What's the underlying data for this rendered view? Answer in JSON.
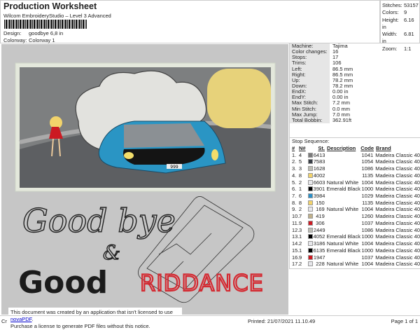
{
  "header": {
    "title": "Production Worksheet",
    "subtitle": "Wilcom EmbroideryStudio – Level 3 Advanced",
    "design_label": "Design:",
    "design_value": "goodbye 6,8 in",
    "colorway_label": "Colorway:",
    "colorway_value": "Colorway 1"
  },
  "stats": [
    [
      "Stitches:",
      "53157"
    ],
    [
      "Colors:",
      "9"
    ],
    [
      "Height:",
      "6.16 in"
    ],
    [
      "Width:",
      "6.81 in"
    ],
    [
      "Zoom:",
      "1:1"
    ]
  ],
  "info": [
    [
      "Machine:",
      "Tajima"
    ],
    [
      "Color changes:",
      "16"
    ],
    [
      "Stops:",
      "17"
    ],
    [
      "Trims:",
      "106"
    ],
    [
      "Left:",
      "86.5 mm"
    ],
    [
      "Right:",
      "86.5 mm"
    ],
    [
      "Up:",
      "78.2 mm"
    ],
    [
      "Down:",
      "78.2 mm"
    ],
    [
      "EndX:",
      "0.00 in"
    ],
    [
      "EndY:",
      "0.00 in"
    ],
    [
      "Max Stitch:",
      "7.2 mm"
    ],
    [
      "Min Stitch:",
      "0.0 mm"
    ],
    [
      "Max Jump:",
      "7.0 mm"
    ],
    [
      "Total Bobbin:",
      "362.91ft"
    ]
  ],
  "stop_sequence": {
    "caption": "Stop Sequence:",
    "headers": [
      "#",
      "N#",
      "St.",
      "Description",
      "Code",
      "Brand"
    ],
    "rows": [
      [
        "1.",
        "4",
        "#7a7a7a",
        "6413",
        "",
        "1041",
        "Madeira Classic 40"
      ],
      [
        "2.",
        "5",
        "#3a3f47",
        "7583",
        "",
        "1054",
        "Madeira Classic 40"
      ],
      [
        "3.",
        "3",
        "#bdbdb5",
        "1628",
        "",
        "1086",
        "Madeira Classic 40"
      ],
      [
        "4.",
        "8",
        "#f2d36b",
        "4002",
        "",
        "1135",
        "Madeira Classic 40"
      ],
      [
        "5.",
        "2",
        "#e6e6ea",
        "6603",
        "Natural White",
        "1004",
        "Madeira Classic 40"
      ],
      [
        "6.",
        "1",
        "#000000",
        "3901",
        "Emerald Black",
        "1000",
        "Madeira Classic 40"
      ],
      [
        "7.",
        "6",
        "#2a8fc8",
        "3984",
        "",
        "1029",
        "Madeira Classic 40"
      ],
      [
        "8.",
        "8",
        "#f2d36b",
        "150",
        "",
        "1135",
        "Madeira Classic 40"
      ],
      [
        "9.",
        "2",
        "#e6e6ea",
        "169",
        "Natural White",
        "1004",
        "Madeira Classic 40"
      ],
      [
        "10.",
        "7",
        "#bfb08a",
        "419",
        "",
        "1260",
        "Madeira Classic 40"
      ],
      [
        "11.",
        "9",
        "#cc1a22",
        "306",
        "",
        "1037",
        "Madeira Classic 40"
      ],
      [
        "12.",
        "3",
        "#bdbdb5",
        "2449",
        "",
        "1086",
        "Madeira Classic 40"
      ],
      [
        "13.",
        "1",
        "#000000",
        "4052",
        "Emerald Black",
        "1000",
        "Madeira Classic 40"
      ],
      [
        "14.",
        "2",
        "#e6e6ea",
        "3186",
        "Natural White",
        "1004",
        "Madeira Classic 40"
      ],
      [
        "15.",
        "1",
        "#000000",
        "6135",
        "Emerald Black",
        "1000",
        "Madeira Classic 40"
      ],
      [
        "16.",
        "9",
        "#cc1a22",
        "1947",
        "",
        "1037",
        "Madeira Classic 40"
      ],
      [
        "17.",
        "2",
        "#e6e6ea",
        "228",
        "Natural White",
        "1004",
        "Madeira Classic 40"
      ]
    ]
  },
  "artwork": {
    "line1": "Good bye",
    "amp": "&",
    "good": "Good",
    "riddance": "RIDDANCE",
    "plate": "999"
  },
  "notice": {
    "line1": "This document was created by an application that isn't licensed to use ",
    "link": "novaPDF",
    "line1_end": ".",
    "line2": "Purchase a license to generate PDF files without this notice."
  },
  "footer": {
    "left": "Cr",
    "printed": "Printed: 21/07/2021 11.10.49",
    "page": "Page 1 of 1"
  }
}
